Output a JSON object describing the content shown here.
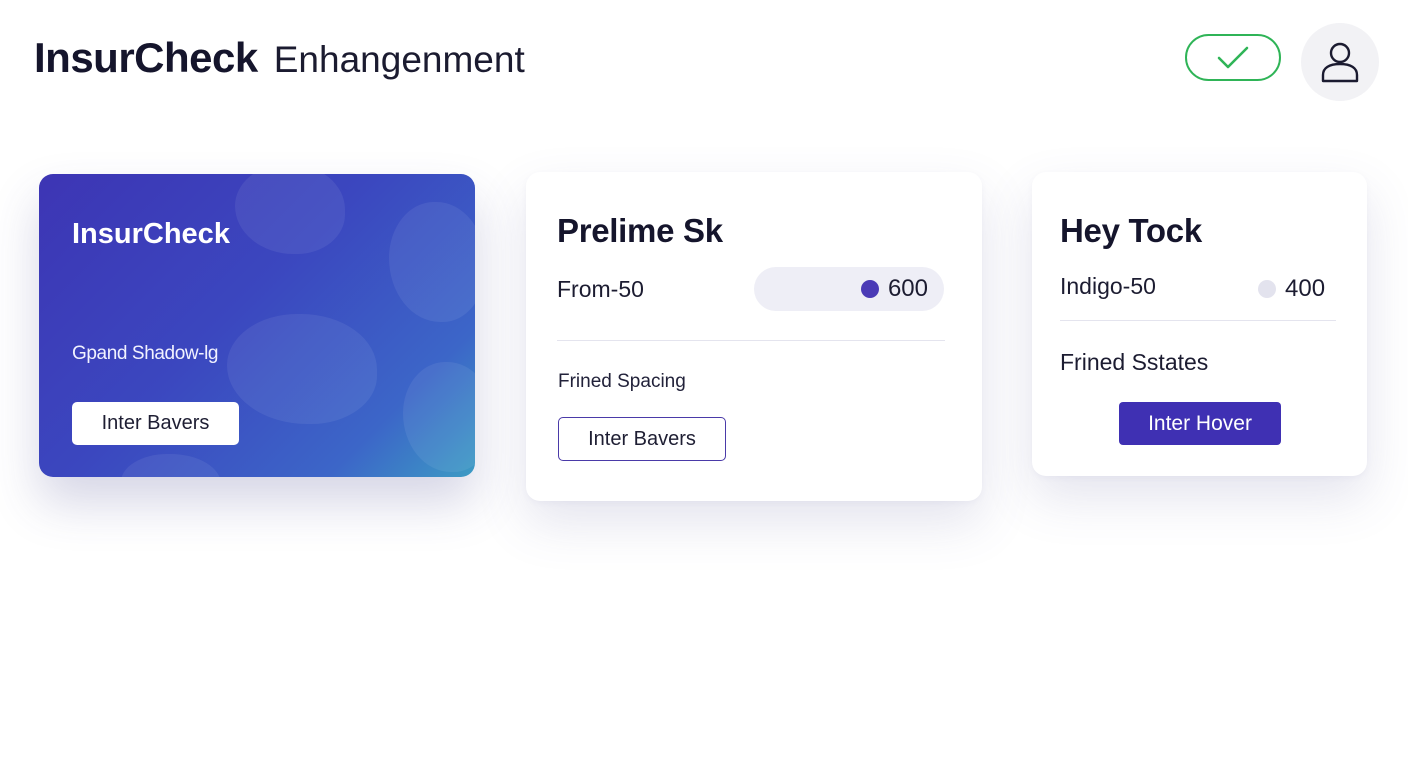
{
  "header": {
    "brand": "InsurCheck",
    "subtitle": "Enhangenment",
    "check_icon": "checkmark-icon",
    "profile_icon": "user-icon"
  },
  "colors": {
    "accent": "#3f30b3",
    "success": "#2fb457",
    "gradient_start": "#3d35b4",
    "gradient_end": "#3c9bc4",
    "pill_dot": "#4a3ab6",
    "muted_dot": "#e3e3ee"
  },
  "cards": {
    "brand": {
      "title": "InsurCheck",
      "description": "Gpand Shadow-lg",
      "button_label": "Inter Bavers"
    },
    "middle": {
      "title": "Prelime Sk",
      "row_label": "From-50",
      "pill_value": "600",
      "section_label": "Frined Spacing",
      "button_label": "Inter Bavers"
    },
    "right": {
      "title": "Hey Tock",
      "row_label": "Indigo-50",
      "status_value": "400",
      "section_label": "Frined Sstates",
      "button_label": "Inter Hover"
    }
  }
}
